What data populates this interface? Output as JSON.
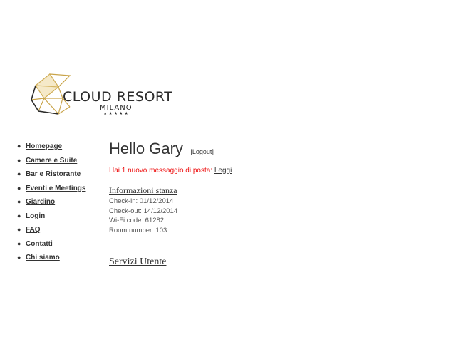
{
  "brand": {
    "name": "CLOUD RESORT",
    "city": "MILANO",
    "stars": "★★★★★",
    "colors": {
      "gold": "#c9a44a",
      "dark": "#2b2b2b"
    }
  },
  "nav": {
    "items": [
      {
        "label": "Homepage"
      },
      {
        "label": "Camere e Suite"
      },
      {
        "label": "Bar e Ristorante"
      },
      {
        "label": "Eventi e Meetings"
      },
      {
        "label": "Giardino"
      },
      {
        "label": "Login"
      },
      {
        "label": "FAQ"
      },
      {
        "label": "Contatti"
      },
      {
        "label": "Chi siamo"
      }
    ]
  },
  "main": {
    "greeting": "Hello Gary",
    "logout_label": "Logout",
    "message_text": "Hai 1 nuovo messaggio di posta:",
    "message_link": "Leggi",
    "message_color": "#ee1111",
    "room_info": {
      "title": "Informazioni stanza",
      "check_in": "Check-in: 01/12/2014",
      "check_out": "Check-out: 14/12/2014",
      "wifi": "Wi-Fi code: 61282",
      "room_number": "Room number: 103"
    },
    "services_title": "Servizi Utente"
  }
}
